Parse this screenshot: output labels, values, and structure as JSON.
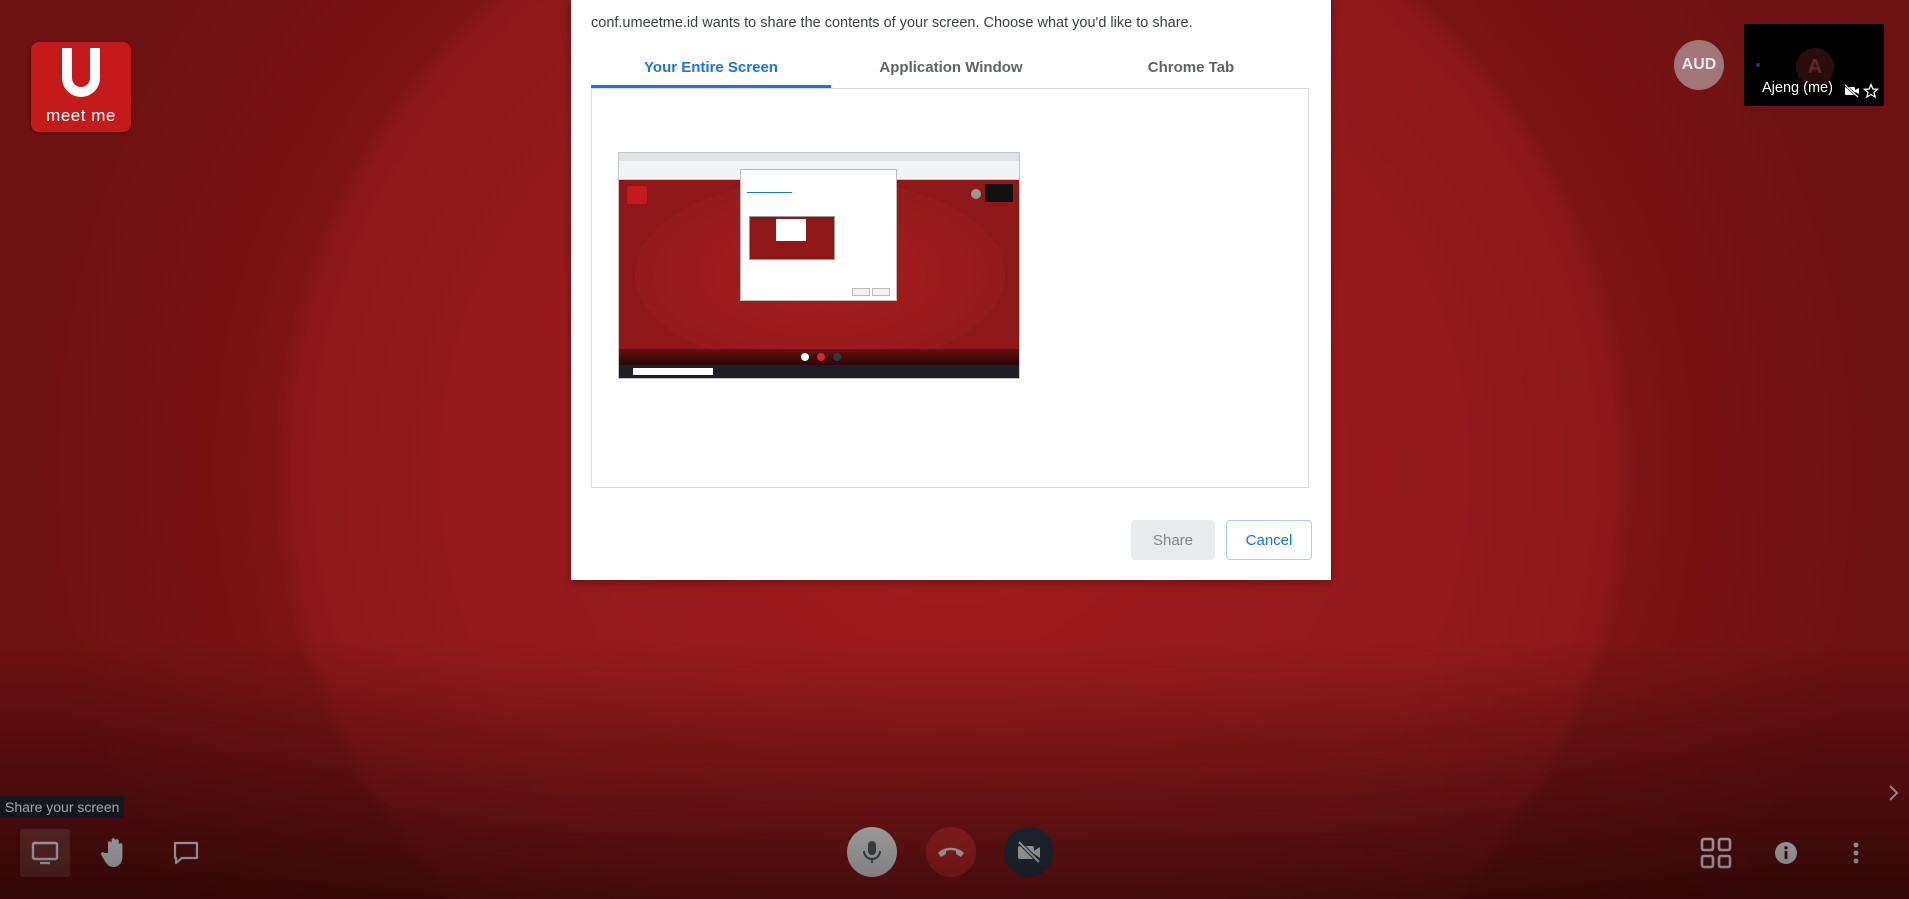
{
  "app": {
    "logo_text": "meet me",
    "brand_color": "#c41a1b"
  },
  "share_dialog": {
    "description": "conf.umeetme.id wants to share the contents of your screen. Choose what you'd like to share.",
    "tabs": [
      {
        "label": "Your Entire Screen",
        "active": true
      },
      {
        "label": "Application Window",
        "active": false
      },
      {
        "label": "Chrome Tab",
        "active": false
      }
    ],
    "share_label": "Share",
    "cancel_label": "Cancel",
    "accent_color": "#1a73e8"
  },
  "participants": {
    "audio_avatar": "AUD",
    "self_initial": "A",
    "self_name": "Ajeng (me)"
  },
  "toolbar": {
    "tooltip": "Share your screen",
    "left_icons": [
      "screen-share-icon",
      "raise-hand-icon",
      "chat-icon"
    ],
    "center_icons": [
      "microphone-icon",
      "hangup-icon",
      "camera-off-icon"
    ],
    "right_icons": [
      "tile-view-icon",
      "info-icon",
      "more-icon"
    ]
  }
}
